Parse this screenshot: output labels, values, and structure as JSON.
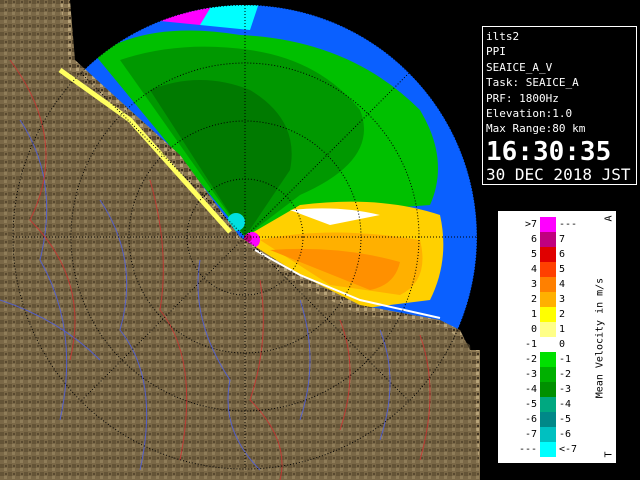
{
  "info": {
    "station": "ilts2",
    "scan_type": "PPI",
    "product": "SEAICE_A_V",
    "task": "Task: SEAICE_A",
    "prf": "PRF: 1800Hz",
    "elevation": "Elevation:1.0",
    "max_range": "Max Range:80 km",
    "time": "16:30:35",
    "date": "30 DEC 2018 JST"
  },
  "legend": {
    "title": "Mean Velocity in m/s",
    "top_marker": "A",
    "bottom_marker": "T",
    "rows": [
      {
        "left": ">7",
        "right": "---",
        "color": "#ff00ff"
      },
      {
        "left": "6",
        "right": "7",
        "color": "#c0007f"
      },
      {
        "left": "5",
        "right": "6",
        "color": "#e00000"
      },
      {
        "left": "4",
        "right": "5",
        "color": "#ff4000"
      },
      {
        "left": "3",
        "right": "4",
        "color": "#ff8000"
      },
      {
        "left": "2",
        "right": "3",
        "color": "#ffb000"
      },
      {
        "left": "1",
        "right": "2",
        "color": "#ffff00"
      },
      {
        "left": "0",
        "right": "1",
        "color": "#ffff88"
      },
      {
        "left": "-1",
        "right": "0",
        "color": "#ffffff"
      },
      {
        "left": "-2",
        "right": "-1",
        "color": "#00e000"
      },
      {
        "left": "-3",
        "right": "-2",
        "color": "#00b000"
      },
      {
        "left": "-4",
        "right": "-3",
        "color": "#009000"
      },
      {
        "left": "-5",
        "right": "-4",
        "color": "#00a880"
      },
      {
        "left": "-6",
        "right": "-5",
        "color": "#008888"
      },
      {
        "left": "-7",
        "right": "-6",
        "color": "#00c0c0"
      },
      {
        "left": "---",
        "right": "<-7",
        "color": "#00ffff"
      }
    ]
  },
  "colors": {
    "land": "#7a6a4a",
    "sea_background": "#0060ff",
    "range_ring": "#000000"
  }
}
